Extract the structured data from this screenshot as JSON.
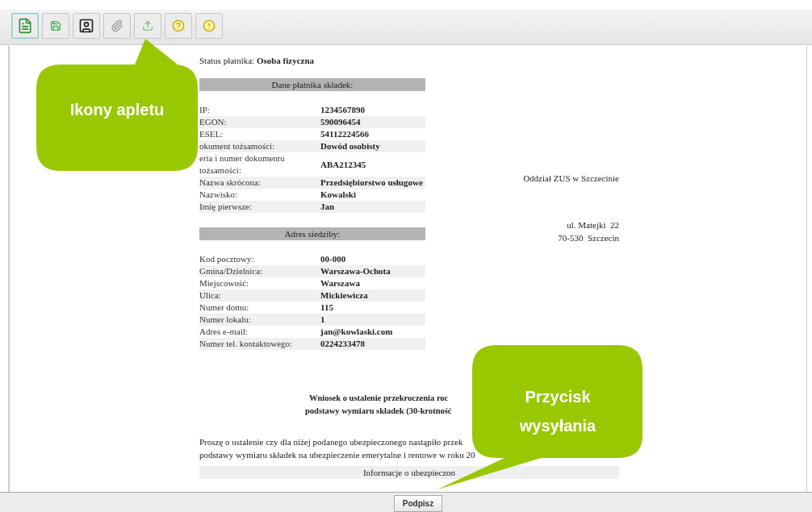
{
  "toolbar": {
    "buttons": [
      {
        "selected": true
      },
      {
        "selected": false
      },
      {
        "selected": false
      },
      {
        "selected": false
      },
      {
        "selected": false
      },
      {
        "selected": false
      },
      {
        "selected": false
      }
    ]
  },
  "document": {
    "status": {
      "label": "Status płatnika:",
      "value": "Osoba fizyczna"
    },
    "sections": [
      {
        "title": "Dane płatnika składek:",
        "rows": [
          {
            "label": "IP:",
            "value": "1234567890"
          },
          {
            "label": "EGON:",
            "value": "590096454"
          },
          {
            "label": "ESEL:",
            "value": "54112224566"
          },
          {
            "label": "okument tożsamości:",
            "value": "Dowód osobisty"
          },
          {
            "label": "eria i numer dokumentu tożsamości:",
            "value": "ABA212345"
          },
          {
            "label": "Nazwa skrócona:",
            "value": "Przedsiębiorstwo usługowe"
          },
          {
            "label": "Nazwisko:",
            "value": "Kowalski"
          },
          {
            "label": "Imię pierwsze:",
            "value": "Jan"
          }
        ]
      },
      {
        "title": "Adres siedziby:",
        "rows": [
          {
            "label": "Kod pocztowy:",
            "value": "00-000"
          },
          {
            "label": "Gmina/Dzielnica:",
            "value": "Warszawa-Ochota"
          },
          {
            "label": "Miejscowość:",
            "value": "Warszawa"
          },
          {
            "label": "Ulica:",
            "value": "Mickiewicza"
          },
          {
            "label": "Numer domu:",
            "value": "115"
          },
          {
            "label": "Numer lokalu:",
            "value": "1"
          },
          {
            "label": "Adres e-mail:",
            "value": "jan@kowlaski.com"
          },
          {
            "label": "Numer tel. kontaktowego:",
            "value": "0224233478"
          }
        ]
      }
    ],
    "office": {
      "name": "Oddział ZUS w Szczecinie",
      "address": [
        "ul. Matejki  22",
        "70-530  Szczecin"
      ]
    },
    "request_title": [
      "Wniosek o ustalenie przekroczenia roc",
      "podstawy wymiaru składek (30-krotność"
    ],
    "request_text": [
      "Proszę o ustalenie czy dla niżej podanego ubezpieczonego nastąpiło przek",
      "podstawy wymiaru składek na ubezpieczenie emerytalne i rentowe w roku 20"
    ],
    "info_header": "Informacje o ubezpieczon"
  },
  "sign_button": "Podpisz",
  "callouts": [
    {
      "text": "Ikony apletu"
    },
    {
      "text": "Przycisk wysyłania"
    }
  ]
}
